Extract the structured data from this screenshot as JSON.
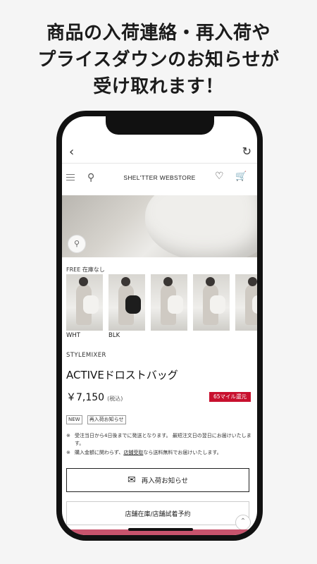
{
  "headline": {
    "line1": "商品の入荷連絡・再入荷や",
    "line2": "プライスダウンのお知らせが",
    "line3": "受け取れます！"
  },
  "app_bar": {
    "back_icon": "chevron-left-icon",
    "reload_icon": "reload-icon"
  },
  "store_header": {
    "logo": "SHEL'TTER WEBSTORE",
    "icons": [
      "menu-icon",
      "search-icon",
      "heart-icon",
      "cart-icon"
    ]
  },
  "product": {
    "stock_label": "FREE 在庫なし",
    "colors": [
      {
        "label": "WHT"
      },
      {
        "label": "BLK"
      },
      {
        "label": ""
      },
      {
        "label": ""
      },
      {
        "label": ""
      }
    ],
    "brand": "STYLEMIXER",
    "name": "ACTIVEドロストバッグ",
    "price": "￥7,150",
    "tax_note": "(税込)",
    "mile_badge": "65マイル還元",
    "tags": [
      "NEW",
      "再入荷お知らせ"
    ],
    "notes": [
      {
        "mark": "※",
        "text": "受注当日から4日後までに発送となります。 最短注文日の翌日にお届けいたします。"
      },
      {
        "mark": "※",
        "text_before": "購入金額に関わらず、",
        "link": "店舗受取",
        "text_after": "なら送料無料でお届けいたします。"
      }
    ]
  },
  "actions": {
    "restock_button": "再入荷お知らせ",
    "store_button": "店舗在庫/店舗試着予約"
  },
  "colors": {
    "accent_red": "#c8102e",
    "bottom_accent": "#c8546d"
  }
}
